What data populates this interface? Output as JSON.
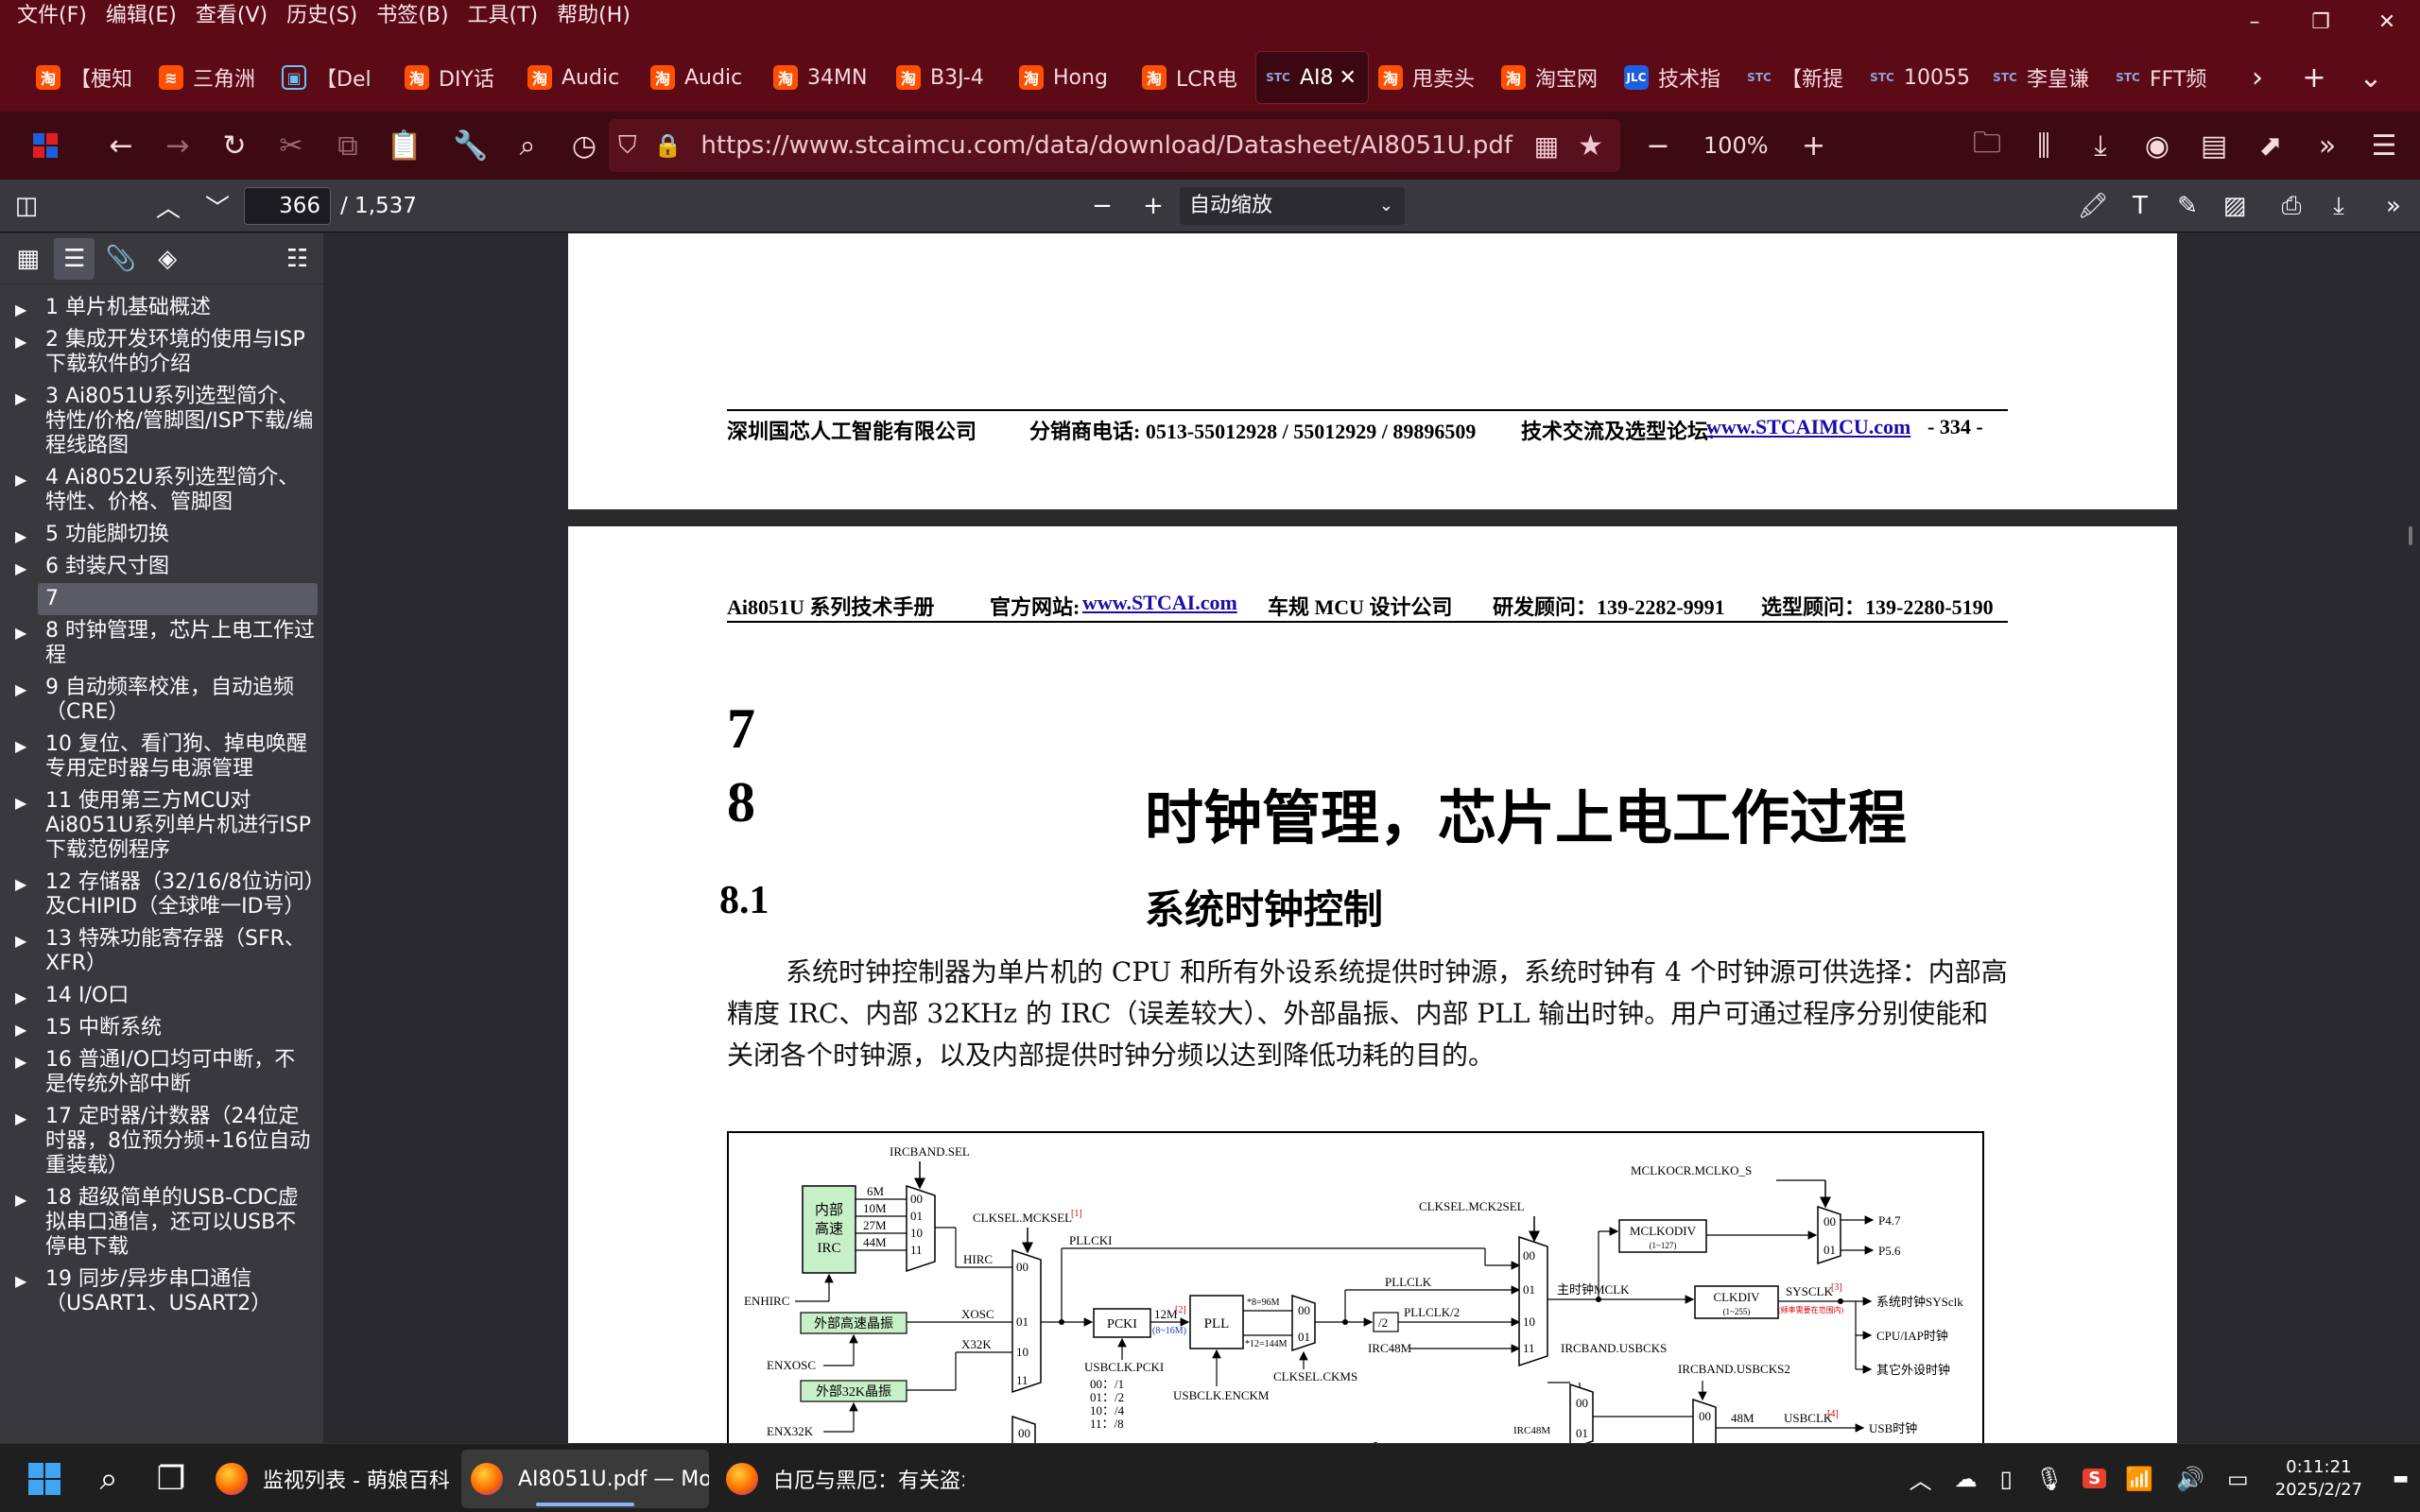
{
  "menu": [
    "文件(F)",
    "编辑(E)",
    "查看(V)",
    "历史(S)",
    "书签(B)",
    "工具(T)",
    "帮助(H)"
  ],
  "window_controls": {
    "minimize": "–",
    "restore": "❐",
    "close": "✕"
  },
  "tabs": [
    {
      "label": "【梗知",
      "icon": "淘"
    },
    {
      "label": "三角洲",
      "icon": "≋"
    },
    {
      "label": "【Del",
      "icon": "▣"
    },
    {
      "label": "DIY话",
      "icon": "淘"
    },
    {
      "label": "Audic",
      "icon": "淘"
    },
    {
      "label": "Audic",
      "icon": "淘"
    },
    {
      "label": "34MN",
      "icon": "淘"
    },
    {
      "label": "B3J-4",
      "icon": "淘"
    },
    {
      "label": "Hong",
      "icon": "淘"
    },
    {
      "label": "LCR电",
      "icon": "淘"
    },
    {
      "label": "AI8",
      "icon": "STC",
      "active": true
    },
    {
      "label": "甩卖头",
      "icon": "淘"
    },
    {
      "label": "淘宝网",
      "icon": "淘"
    },
    {
      "label": "技术指",
      "icon": "JLC"
    },
    {
      "label": "【新提",
      "icon": "STC"
    },
    {
      "label": "10055",
      "icon": "STC"
    },
    {
      "label": "李皇谦",
      "icon": "STC"
    },
    {
      "label": "FFT频",
      "icon": "STC"
    }
  ],
  "url": "https://www.stcaimcu.com/data/download/Datasheet/AI8051U.pdf",
  "zoom": "100%",
  "pdf": {
    "page": "366",
    "total": "/ 1,537",
    "scale": "自动缩放"
  },
  "outline": [
    {
      "label": "1 单片机基础概述"
    },
    {
      "label": "2 集成开发环境的使用与ISP下载软件的介绍"
    },
    {
      "label": "3 Ai8051U系列选型简介、特性/价格/管脚图/ISP下载/编程线路图"
    },
    {
      "label": "4 Ai8052U系列选型简介、特性、价格、管脚图"
    },
    {
      "label": "5 功能脚切换"
    },
    {
      "label": "6 封装尺寸图"
    },
    {
      "label": "7",
      "selected": true
    },
    {
      "label": "8 时钟管理，芯片上电工作过程"
    },
    {
      "label": "9 自动频率校准，自动追频（CRE）"
    },
    {
      "label": "10 复位、看门狗、掉电唤醒专用定时器与电源管理"
    },
    {
      "label": "11 使用第三方MCU对Ai8051U系列单片机进行ISP下载范例程序"
    },
    {
      "label": "12 存储器（32/16/8位访问）及CHIPID（全球唯一ID号）"
    },
    {
      "label": "13 特殊功能寄存器（SFR、XFR）"
    },
    {
      "label": "14 I/O口"
    },
    {
      "label": "15 中断系统"
    },
    {
      "label": "16 普通I/O口均可中断，不是传统外部中断"
    },
    {
      "label": "17 定时器/计数器（24位定时器，8位预分频+16位自动重装载）"
    },
    {
      "label": "18 超级简单的USB-CDC虚拟串口通信，还可以USB不停电下载"
    },
    {
      "label": "19 同步/异步串口通信（USART1、USART2）"
    }
  ],
  "page1": {
    "company": "深圳国芯人工智能有限公司",
    "phone": "分销商电话: 0513-55012928 / 55012929 / 89896509",
    "forum_label": "技术交流及选型论坛:",
    "forum_link": "www.STCAIMCU.com",
    "page_no": "- 334 -"
  },
  "page2": {
    "manual": "Ai8051U 系列技术手册",
    "site_label": "官方网站:",
    "site_link": "www.STCAI.com",
    "slogan": "车规 MCU 设计公司",
    "rd": "研发顾问：139-2282-9991",
    "sel": "选型顾问：139-2280-5190",
    "ch7": "7",
    "ch8": "8",
    "ch8_title": "时钟管理，芯片上电工作过程",
    "sec81": "8.1",
    "sec81_title": "系统时钟控制",
    "para": "系统时钟控制器为单片机的 CPU 和所有外设系统提供时钟源，系统时钟有 4 个时钟源可供选择：内部高精度 IRC、内部 32KHz 的 IRC（误差较大）、外部晶振、内部 PLL 输出时钟。用户可通过程序分别使能和关闭各个时钟源，以及内部提供时钟分频以达到降低功耗的目的。"
  },
  "diagram": {
    "irc_sel": "IRCBAND.SEL",
    "irc_block": [
      "内部",
      "高速",
      "IRC"
    ],
    "freqs": [
      "6M",
      "10M",
      "27M",
      "44M"
    ],
    "mux_inputs": [
      "00",
      "01",
      "10",
      "11"
    ],
    "enhirc": "ENHIRC",
    "ext_hs": "外部高速晶振",
    "enxosc": "ENXOSC",
    "ext_32k": "外部32K晶振",
    "enx32k": "ENX32K",
    "clksel": "CLKSEL.MCKSEL",
    "clksel_sup": "[1]",
    "hirc": "HIRC",
    "xosc": "XOSC",
    "x32k": "X32K",
    "pllcki": "PLLCKI",
    "pcki": "PCKI",
    "pcki_out": "12M",
    "pcki_sup": "[2]",
    "pcki_range": "(8~16M)",
    "usbclk_pcki": "USBCLK.PCKI",
    "div_table": [
      "00：/1",
      "01：/2",
      "10：/4",
      "11：/8"
    ],
    "pll": "PLL",
    "pll_96": "*8=96M",
    "pll_144": "*12=144M",
    "usbclk_enckm": "USBCLK.ENCKM",
    "clksel_ckms": "CLKSEL.CKMS",
    "pllclk": "PLLCLK",
    "pllclk2": "PLLCLK/2",
    "div2": "/2",
    "irc48m": "IRC48M",
    "clksel2": "CLKSEL.MCK2SEL",
    "main_clk": "主时钟MCLK",
    "mclkodiv": "MCLKODIV",
    "mclkodiv_range": "(1~127)",
    "clkdiv": "CLKDIV",
    "clkdiv_range": "(1~255)",
    "mclkocr": "MCLKOCR.MCLKO_S",
    "p47": "P4.7",
    "p56": "P5.6",
    "sysclk": "SYSCLK",
    "sysclk_sup": "[3]",
    "sysclk_note": "(频率需要在范围内)",
    "out_sys": "系统时钟SYSclk",
    "out_cpu": "CPU/IAP时钟",
    "out_periph": "其它外设时钟",
    "usbcks": "IRCBAND.USBCKS",
    "usbcks2": "IRCBAND.USBCKS2",
    "m48": "48M",
    "usbclk": "USBCLK",
    "usbclk_sup": "[4]",
    "out_usb": "USB时钟"
  },
  "taskbar": {
    "apps": [
      {
        "label": "监视列表 - 萌娘百科 :"
      },
      {
        "label": "AI8051U.pdf — Mozil",
        "active": true
      },
      {
        "label": "白厄与黑厄：有关盗>"
      }
    ],
    "time": "0:11:21",
    "date": "2025/2/27",
    "input_method": "S"
  },
  "colors": {
    "titlebar": "#5b0a16",
    "navbar": "#3d0a14",
    "accent": "#8ab4f8"
  }
}
